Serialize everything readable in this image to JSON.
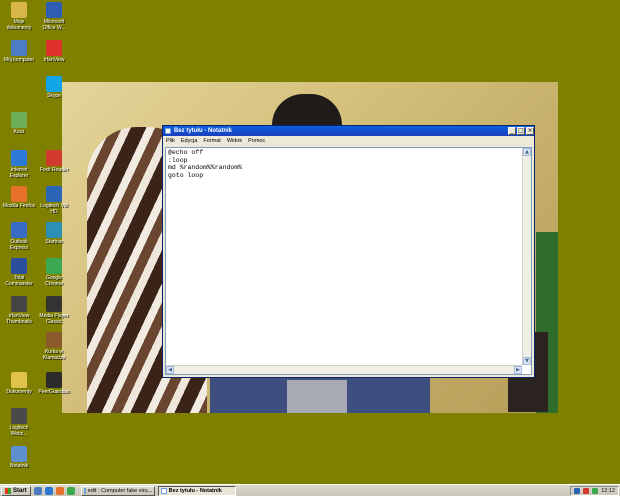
{
  "desktop": {
    "icons": [
      {
        "label": "Moje dokumenty",
        "color": "#d9b64a"
      },
      {
        "label": "Microsoft Office W...",
        "color": "#2f5fb5"
      },
      {
        "label": "Mój komputer",
        "color": "#4d7cc4"
      },
      {
        "label": "IrfanView",
        "color": "#e0302a"
      },
      {
        "label": "Skype",
        "color": "#12a5e6"
      },
      {
        "label": "Kosz",
        "color": "#6fae58"
      },
      {
        "label": "Internet Explorer",
        "color": "#2c7ad6"
      },
      {
        "label": "Foxit Reader",
        "color": "#d13a2c"
      },
      {
        "label": "Mozilla Firefox",
        "color": "#e5712a"
      },
      {
        "label": "Logitech Vid HD",
        "color": "#2a66b5"
      },
      {
        "label": "Outlook Express",
        "color": "#3b6cc5"
      },
      {
        "label": "Startnie",
        "color": "#2c8fb5"
      },
      {
        "label": "Total Commander",
        "color": "#2b4f9c"
      },
      {
        "label": "Google Chrome",
        "color": "#3aa94f"
      },
      {
        "label": "IrfanView Thumbnails",
        "color": "#444444"
      },
      {
        "label": "Media Player Classic",
        "color": "#333333"
      },
      {
        "label": "Kurka w Klamadze",
        "color": "#8a5a2b"
      },
      {
        "label": "Dokumenty",
        "color": "#e0c14a"
      },
      {
        "label": "PeerGuardian",
        "color": "#2b2b2b"
      },
      {
        "label": "Logitech Webc...",
        "color": "#4a4a4a"
      },
      {
        "label": "Notatnik",
        "color": "#5e8fcf"
      }
    ]
  },
  "notepad": {
    "title": "Bez tytułu - Notatnik",
    "menu": [
      "Plik",
      "Edycja",
      "Format",
      "Widok",
      "Pomoc"
    ],
    "content": "@echo off\n:loop\nmd %random%%random%\ngoto loop"
  },
  "taskbar": {
    "start_label": "Start",
    "tasks": [
      {
        "label": "edit : Computer fake viru...",
        "active": false
      },
      {
        "label": "Bez tytułu - Notatnik",
        "active": true
      }
    ],
    "clock": "12:12"
  }
}
